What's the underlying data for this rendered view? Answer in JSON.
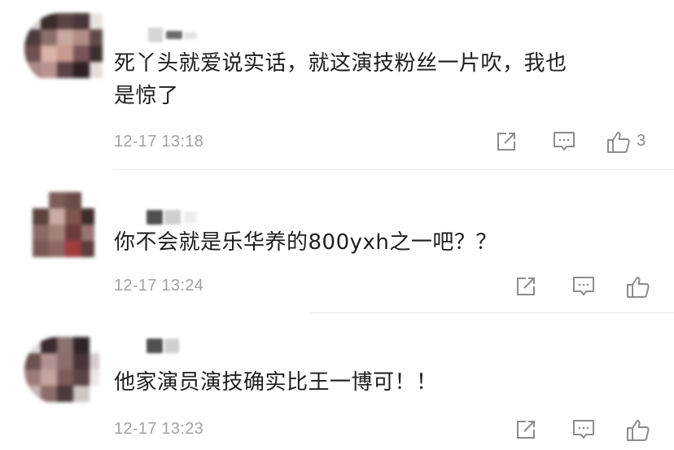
{
  "comments": [
    {
      "text_line1": "死丫头就爱说实话，就这演技粉丝一片吹，我也",
      "text_line2": "是惊了",
      "time": "12-17 13:18",
      "likes": "3"
    },
    {
      "text_line1": "你不会就是乐华养的800yxh之一吧？？",
      "time": "12-17 13:24",
      "likes": ""
    },
    {
      "text_line1": "他家演员演技确实比王一博可！！",
      "time": "12-17 13:23",
      "likes": ""
    }
  ],
  "icons": {
    "share": "share-icon",
    "reply": "comment-icon",
    "like": "thumbs-up-icon"
  },
  "colors": {
    "text": "#1e1e1e",
    "meta": "#a2a2a2",
    "icon": "#8c8c8c",
    "divider": "#e7e7e7"
  }
}
